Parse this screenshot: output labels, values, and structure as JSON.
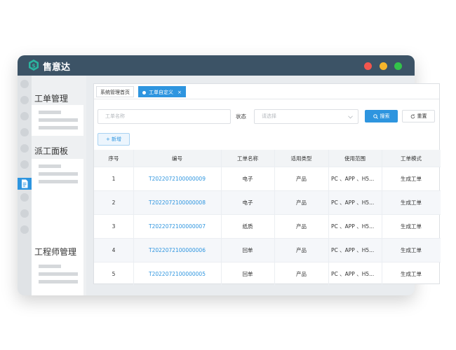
{
  "app": {
    "title": "售意达"
  },
  "window_controls": {
    "colors": [
      "#f2564e",
      "#f6b52b",
      "#33c24a"
    ]
  },
  "sidebar": {
    "groups": [
      {
        "label": "工单管理"
      },
      {
        "label": "派工面板"
      },
      {
        "label": "工程师管理"
      }
    ]
  },
  "tabs": [
    {
      "label": "系统管理首页",
      "active": false
    },
    {
      "label": "工单自定义",
      "active": true,
      "close": "×"
    }
  ],
  "search": {
    "name_placeholder": "工单名称",
    "status_label": "状态",
    "status_placeholder": "请选择",
    "search_button": "搜索",
    "reset_button": "重置",
    "add_button": "+ 新增"
  },
  "table": {
    "columns": [
      "序号",
      "编号",
      "工单名称",
      "适用类型",
      "使用范围",
      "工单模式"
    ],
    "rows": [
      [
        "1",
        "T2022072100000009",
        "电子",
        "产品",
        "PC 、APP 、H5...",
        "生成工单"
      ],
      [
        "2",
        "T2022072100000008",
        "电子",
        "产品",
        "PC 、APP 、H5...",
        "生成工单"
      ],
      [
        "3",
        "T2022072100000007",
        "纸质",
        "产品",
        "PC 、APP 、H5...",
        "生成工单"
      ],
      [
        "4",
        "T2022072100000006",
        "回单",
        "产品",
        "PC 、APP 、H5...",
        "生成工单"
      ],
      [
        "5",
        "T2022072100000005",
        "回单",
        "产品",
        "PC 、APP 、H5...",
        "生成工单"
      ]
    ]
  },
  "colors": {
    "accent": "#2e95df",
    "titlebar": "#3c5366"
  }
}
